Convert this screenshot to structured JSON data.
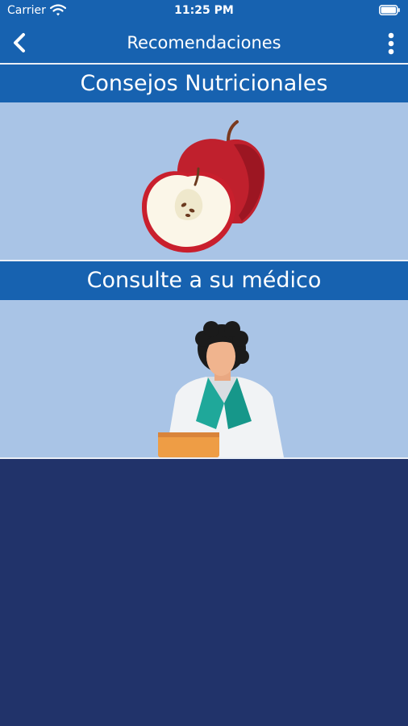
{
  "status_bar": {
    "carrier": "Carrier",
    "time": "11:25 PM",
    "icons": [
      "wifi-icon",
      "battery-icon"
    ]
  },
  "nav": {
    "title": "Recomendaciones",
    "back_icon": "chevron-left-icon",
    "menu_icon": "more-vertical-icon"
  },
  "sections": [
    {
      "title": "Consejos Nutricionales",
      "illustration": "apple-illustration"
    },
    {
      "title": "Consulte a su médico",
      "illustration": "doctor-illustration"
    }
  ],
  "colors": {
    "primary": "#1762b0",
    "panel": "#a9c4e6",
    "background": "#21336a"
  }
}
